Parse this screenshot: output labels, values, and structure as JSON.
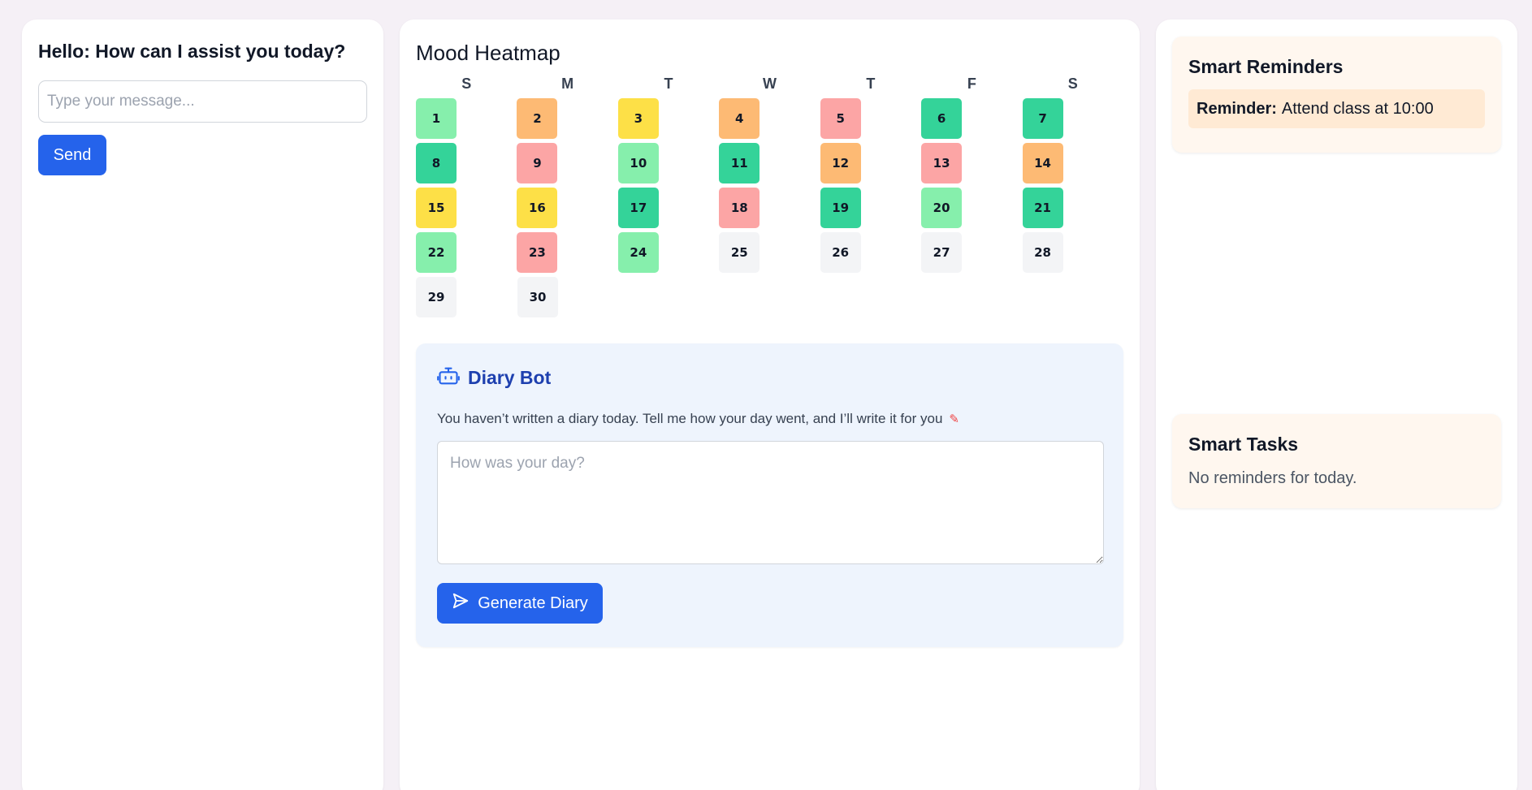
{
  "chat": {
    "heading": "Hello: How can I assist you today?",
    "input_placeholder": "Type your message...",
    "send_label": "Send"
  },
  "mood": {
    "title": "Mood Heatmap",
    "weekdays": [
      "S",
      "M",
      "T",
      "W",
      "T",
      "F",
      "S"
    ],
    "days": [
      {
        "label": "1",
        "color": "#86efac"
      },
      {
        "label": "2",
        "color": "#fdba74"
      },
      {
        "label": "3",
        "color": "#fde047"
      },
      {
        "label": "4",
        "color": "#fdba74"
      },
      {
        "label": "5",
        "color": "#fca5a5"
      },
      {
        "label": "6",
        "color": "#34d399"
      },
      {
        "label": "7",
        "color": "#34d399"
      },
      {
        "label": "8",
        "color": "#34d399"
      },
      {
        "label": "9",
        "color": "#fca5a5"
      },
      {
        "label": "10",
        "color": "#86efac"
      },
      {
        "label": "11",
        "color": "#34d399"
      },
      {
        "label": "12",
        "color": "#fdba74"
      },
      {
        "label": "13",
        "color": "#fca5a5"
      },
      {
        "label": "14",
        "color": "#fdba74"
      },
      {
        "label": "15",
        "color": "#fde047"
      },
      {
        "label": "16",
        "color": "#fde047"
      },
      {
        "label": "17",
        "color": "#34d399"
      },
      {
        "label": "18",
        "color": "#fca5a5"
      },
      {
        "label": "19",
        "color": "#34d399"
      },
      {
        "label": "20",
        "color": "#86efac"
      },
      {
        "label": "21",
        "color": "#34d399"
      },
      {
        "label": "22",
        "color": "#86efac"
      },
      {
        "label": "23",
        "color": "#fca5a5"
      },
      {
        "label": "24",
        "color": "#86efac"
      },
      {
        "label": "25",
        "color": "#f3f4f6"
      },
      {
        "label": "26",
        "color": "#f3f4f6"
      },
      {
        "label": "27",
        "color": "#f3f4f6"
      },
      {
        "label": "28",
        "color": "#f3f4f6"
      },
      {
        "label": "29",
        "color": "#f3f4f6"
      },
      {
        "label": "30",
        "color": "#f3f4f6"
      }
    ]
  },
  "diary": {
    "title": "Diary Bot",
    "icon": "robot-icon",
    "prompt_text": "You haven’t written a diary today. Tell me how your day went, and I’ll write it for you",
    "pencil_icon": "pencil-icon",
    "textarea_placeholder": "How was your day?",
    "generate_label": "Generate Diary",
    "accent": "#2563eb"
  },
  "reminders": {
    "title": "Smart Reminders",
    "items": [
      {
        "prefix": "Reminder:",
        "text": "Attend class at 10:00"
      }
    ]
  },
  "tasks": {
    "title": "Smart Tasks",
    "empty_text": "No reminders for today."
  }
}
